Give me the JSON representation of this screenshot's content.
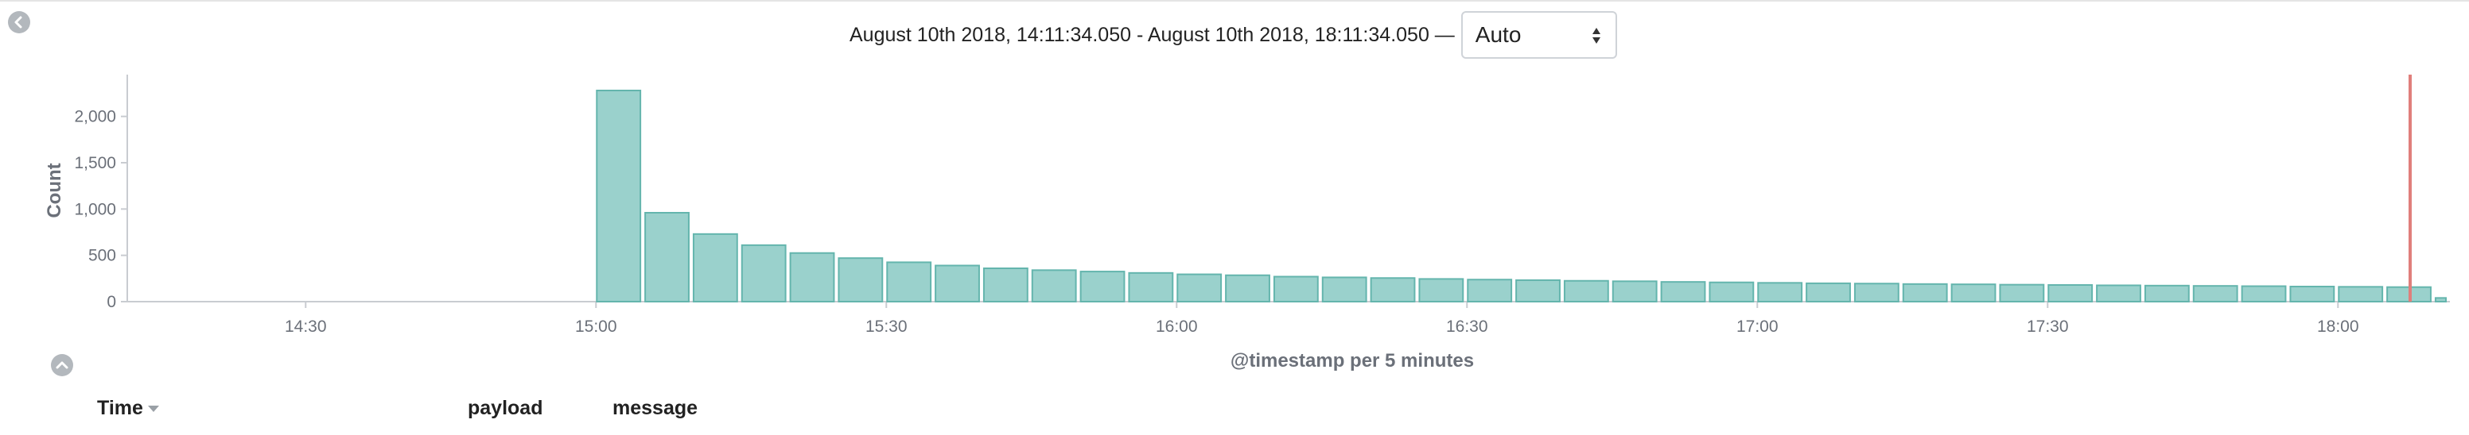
{
  "header": {
    "time_range": "August 10th 2018, 14:11:34.050 - August 10th 2018, 18:11:34.050 —",
    "interval_selected": "Auto"
  },
  "table": {
    "columns": [
      "Time",
      "payload",
      "message"
    ]
  },
  "icons": {
    "left_collapse": "chevron-left-icon",
    "up_collapse": "chevron-up-icon",
    "select": "select-arrows-icon",
    "sort": "sort-down-icon"
  },
  "colors": {
    "bar_fill": "#9ad1cc",
    "bar_stroke": "#64b5ad",
    "axis": "#c9ccd1",
    "now_line": "#e07f7c"
  },
  "chart_data": {
    "type": "bar",
    "ylabel": "Count",
    "xlabel": "@timestamp per 5 minutes",
    "yticks": [
      0,
      500,
      1000,
      1500,
      2000
    ],
    "ytick_labels": [
      "0",
      "500",
      "1,000",
      "1,500",
      "2,000"
    ],
    "xticks": [
      "14:30",
      "15:00",
      "15:30",
      "16:00",
      "16:30",
      "17:00",
      "17:30",
      "18:00"
    ],
    "xlim": [
      "14:11:34",
      "18:11:34"
    ],
    "ylim": [
      0,
      2400
    ],
    "bin_minutes": 5,
    "now_marker": "18:11:34",
    "series": [
      {
        "x": [
          "15:00",
          "15:05",
          "15:10",
          "15:15",
          "15:20",
          "15:25",
          "15:30",
          "15:35",
          "15:40",
          "15:45",
          "15:50",
          "15:55",
          "16:00",
          "16:05",
          "16:10",
          "16:15",
          "16:20",
          "16:25",
          "16:30",
          "16:35",
          "16:40",
          "16:45",
          "16:50",
          "16:55",
          "17:00",
          "17:05",
          "17:10",
          "17:15",
          "17:20",
          "17:25",
          "17:30",
          "17:35",
          "17:40",
          "17:45",
          "17:50",
          "17:55",
          "18:00",
          "18:05",
          "18:10"
        ],
        "values": [
          2280,
          960,
          730,
          610,
          525,
          470,
          425,
          390,
          360,
          340,
          325,
          310,
          295,
          285,
          270,
          262,
          255,
          245,
          238,
          232,
          225,
          220,
          213,
          208,
          203,
          198,
          195,
          190,
          187,
          183,
          180,
          176,
          173,
          170,
          167,
          163,
          160,
          157,
          40
        ]
      }
    ]
  }
}
